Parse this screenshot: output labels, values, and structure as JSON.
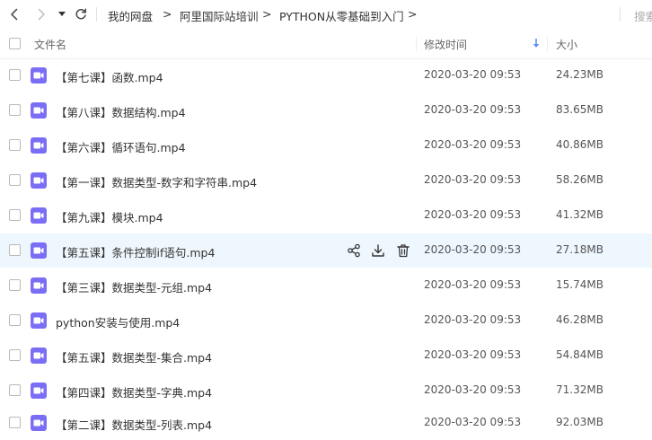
{
  "breadcrumb": [
    {
      "label": "我的网盘"
    },
    {
      "label": "阿里国际站培训"
    },
    {
      "label": "PYTHON从零基础到入门"
    }
  ],
  "breadcrumb_sep": ">",
  "search": {
    "placeholder": "搜索"
  },
  "columns": {
    "name": "文件名",
    "modified": "修改时间",
    "size": "大小"
  },
  "accent_color": "#5b8ff9",
  "file_icon_color": "#7b6ef6",
  "files": [
    {
      "name": "【第七课】函数.mp4",
      "modified": "2020-03-20 09:53",
      "size": "24.23MB"
    },
    {
      "name": "【第八课】数据结构.mp4",
      "modified": "2020-03-20 09:53",
      "size": "83.65MB"
    },
    {
      "name": "【第六课】循环语句.mp4",
      "modified": "2020-03-20 09:53",
      "size": "40.86MB"
    },
    {
      "name": "【第一课】数据类型-数字和字符串.mp4",
      "modified": "2020-03-20 09:53",
      "size": "58.26MB"
    },
    {
      "name": "【第九课】模块.mp4",
      "modified": "2020-03-20 09:53",
      "size": "41.32MB"
    },
    {
      "name": "【第五课】条件控制if语句.mp4",
      "modified": "2020-03-20 09:53",
      "size": "27.18MB"
    },
    {
      "name": "【第三课】数据类型-元组.mp4",
      "modified": "2020-03-20 09:53",
      "size": "15.74MB"
    },
    {
      "name": "python安装与使用.mp4",
      "modified": "2020-03-20 09:53",
      "size": "46.28MB"
    },
    {
      "name": "【第五课】数据类型-集合.mp4",
      "modified": "2020-03-20 09:53",
      "size": "54.84MB"
    },
    {
      "name": "【第四课】数据类型-字典.mp4",
      "modified": "2020-03-20 09:53",
      "size": "71.32MB"
    },
    {
      "name": "【第二课】数据类型-列表.mp4",
      "modified": "2020-03-20 09:53",
      "size": "92.03MB"
    }
  ]
}
